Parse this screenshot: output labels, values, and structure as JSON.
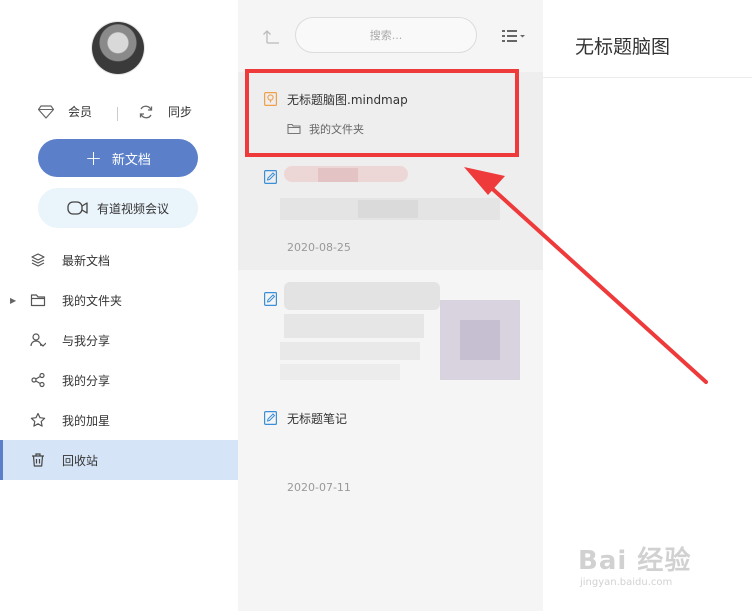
{
  "sidebar": {
    "vip_label": "会员",
    "sync_label": "同步",
    "new_doc_label": "新文档",
    "meeting_label": "有道视频会议",
    "nav": [
      {
        "label": "最新文档",
        "icon": "layers-icon",
        "active": false
      },
      {
        "label": "我的文件夹",
        "icon": "folder-icon",
        "active": false,
        "expandable": true
      },
      {
        "label": "与我分享",
        "icon": "shared-with-me-icon",
        "active": false
      },
      {
        "label": "我的分享",
        "icon": "share-icon",
        "active": false
      },
      {
        "label": "我的加星",
        "icon": "star-icon",
        "active": false
      },
      {
        "label": "回收站",
        "icon": "trash-icon",
        "active": true
      }
    ]
  },
  "list": {
    "search_placeholder": "搜索...",
    "items": [
      {
        "title": "无标题脑图.mindmap",
        "folder": "我的文件夹",
        "icon": "mindmap-icon",
        "selected": true
      },
      {
        "title": "",
        "date": "2020-08-25",
        "icon": "note-icon",
        "blurred": true
      },
      {
        "title": "",
        "date": "",
        "icon": "note-icon",
        "blurred": true
      },
      {
        "title": "无标题笔记",
        "date": "2020-07-11",
        "icon": "note-icon"
      }
    ]
  },
  "detail": {
    "title": "无标题脑图"
  },
  "watermark": {
    "brand": "Bai 经验",
    "url": "jingyan.baidu.com"
  },
  "colors": {
    "accent": "#5b80c9",
    "active_nav_bg": "#d6e4f7",
    "annotation_red": "#ee3a3a",
    "meeting_bg": "#eaf4fb"
  }
}
